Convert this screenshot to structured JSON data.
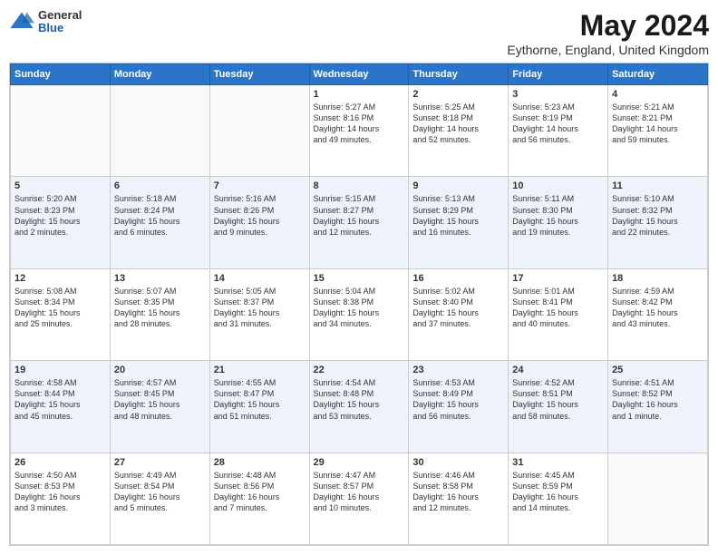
{
  "header": {
    "logo": {
      "general": "General",
      "blue": "Blue"
    },
    "title": "May 2024",
    "location": "Eythorne, England, United Kingdom"
  },
  "weekdays": [
    "Sunday",
    "Monday",
    "Tuesday",
    "Wednesday",
    "Thursday",
    "Friday",
    "Saturday"
  ],
  "weeks": [
    [
      {
        "day": "",
        "info": ""
      },
      {
        "day": "",
        "info": ""
      },
      {
        "day": "",
        "info": ""
      },
      {
        "day": "1",
        "info": "Sunrise: 5:27 AM\nSunset: 8:16 PM\nDaylight: 14 hours\nand 49 minutes."
      },
      {
        "day": "2",
        "info": "Sunrise: 5:25 AM\nSunset: 8:18 PM\nDaylight: 14 hours\nand 52 minutes."
      },
      {
        "day": "3",
        "info": "Sunrise: 5:23 AM\nSunset: 8:19 PM\nDaylight: 14 hours\nand 56 minutes."
      },
      {
        "day": "4",
        "info": "Sunrise: 5:21 AM\nSunset: 8:21 PM\nDaylight: 14 hours\nand 59 minutes."
      }
    ],
    [
      {
        "day": "5",
        "info": "Sunrise: 5:20 AM\nSunset: 8:23 PM\nDaylight: 15 hours\nand 2 minutes."
      },
      {
        "day": "6",
        "info": "Sunrise: 5:18 AM\nSunset: 8:24 PM\nDaylight: 15 hours\nand 6 minutes."
      },
      {
        "day": "7",
        "info": "Sunrise: 5:16 AM\nSunset: 8:26 PM\nDaylight: 15 hours\nand 9 minutes."
      },
      {
        "day": "8",
        "info": "Sunrise: 5:15 AM\nSunset: 8:27 PM\nDaylight: 15 hours\nand 12 minutes."
      },
      {
        "day": "9",
        "info": "Sunrise: 5:13 AM\nSunset: 8:29 PM\nDaylight: 15 hours\nand 16 minutes."
      },
      {
        "day": "10",
        "info": "Sunrise: 5:11 AM\nSunset: 8:30 PM\nDaylight: 15 hours\nand 19 minutes."
      },
      {
        "day": "11",
        "info": "Sunrise: 5:10 AM\nSunset: 8:32 PM\nDaylight: 15 hours\nand 22 minutes."
      }
    ],
    [
      {
        "day": "12",
        "info": "Sunrise: 5:08 AM\nSunset: 8:34 PM\nDaylight: 15 hours\nand 25 minutes."
      },
      {
        "day": "13",
        "info": "Sunrise: 5:07 AM\nSunset: 8:35 PM\nDaylight: 15 hours\nand 28 minutes."
      },
      {
        "day": "14",
        "info": "Sunrise: 5:05 AM\nSunset: 8:37 PM\nDaylight: 15 hours\nand 31 minutes."
      },
      {
        "day": "15",
        "info": "Sunrise: 5:04 AM\nSunset: 8:38 PM\nDaylight: 15 hours\nand 34 minutes."
      },
      {
        "day": "16",
        "info": "Sunrise: 5:02 AM\nSunset: 8:40 PM\nDaylight: 15 hours\nand 37 minutes."
      },
      {
        "day": "17",
        "info": "Sunrise: 5:01 AM\nSunset: 8:41 PM\nDaylight: 15 hours\nand 40 minutes."
      },
      {
        "day": "18",
        "info": "Sunrise: 4:59 AM\nSunset: 8:42 PM\nDaylight: 15 hours\nand 43 minutes."
      }
    ],
    [
      {
        "day": "19",
        "info": "Sunrise: 4:58 AM\nSunset: 8:44 PM\nDaylight: 15 hours\nand 45 minutes."
      },
      {
        "day": "20",
        "info": "Sunrise: 4:57 AM\nSunset: 8:45 PM\nDaylight: 15 hours\nand 48 minutes."
      },
      {
        "day": "21",
        "info": "Sunrise: 4:55 AM\nSunset: 8:47 PM\nDaylight: 15 hours\nand 51 minutes."
      },
      {
        "day": "22",
        "info": "Sunrise: 4:54 AM\nSunset: 8:48 PM\nDaylight: 15 hours\nand 53 minutes."
      },
      {
        "day": "23",
        "info": "Sunrise: 4:53 AM\nSunset: 8:49 PM\nDaylight: 15 hours\nand 56 minutes."
      },
      {
        "day": "24",
        "info": "Sunrise: 4:52 AM\nSunset: 8:51 PM\nDaylight: 15 hours\nand 58 minutes."
      },
      {
        "day": "25",
        "info": "Sunrise: 4:51 AM\nSunset: 8:52 PM\nDaylight: 16 hours\nand 1 minute."
      }
    ],
    [
      {
        "day": "26",
        "info": "Sunrise: 4:50 AM\nSunset: 8:53 PM\nDaylight: 16 hours\nand 3 minutes."
      },
      {
        "day": "27",
        "info": "Sunrise: 4:49 AM\nSunset: 8:54 PM\nDaylight: 16 hours\nand 5 minutes."
      },
      {
        "day": "28",
        "info": "Sunrise: 4:48 AM\nSunset: 8:56 PM\nDaylight: 16 hours\nand 7 minutes."
      },
      {
        "day": "29",
        "info": "Sunrise: 4:47 AM\nSunset: 8:57 PM\nDaylight: 16 hours\nand 10 minutes."
      },
      {
        "day": "30",
        "info": "Sunrise: 4:46 AM\nSunset: 8:58 PM\nDaylight: 16 hours\nand 12 minutes."
      },
      {
        "day": "31",
        "info": "Sunrise: 4:45 AM\nSunset: 8:59 PM\nDaylight: 16 hours\nand 14 minutes."
      },
      {
        "day": "",
        "info": ""
      }
    ]
  ]
}
